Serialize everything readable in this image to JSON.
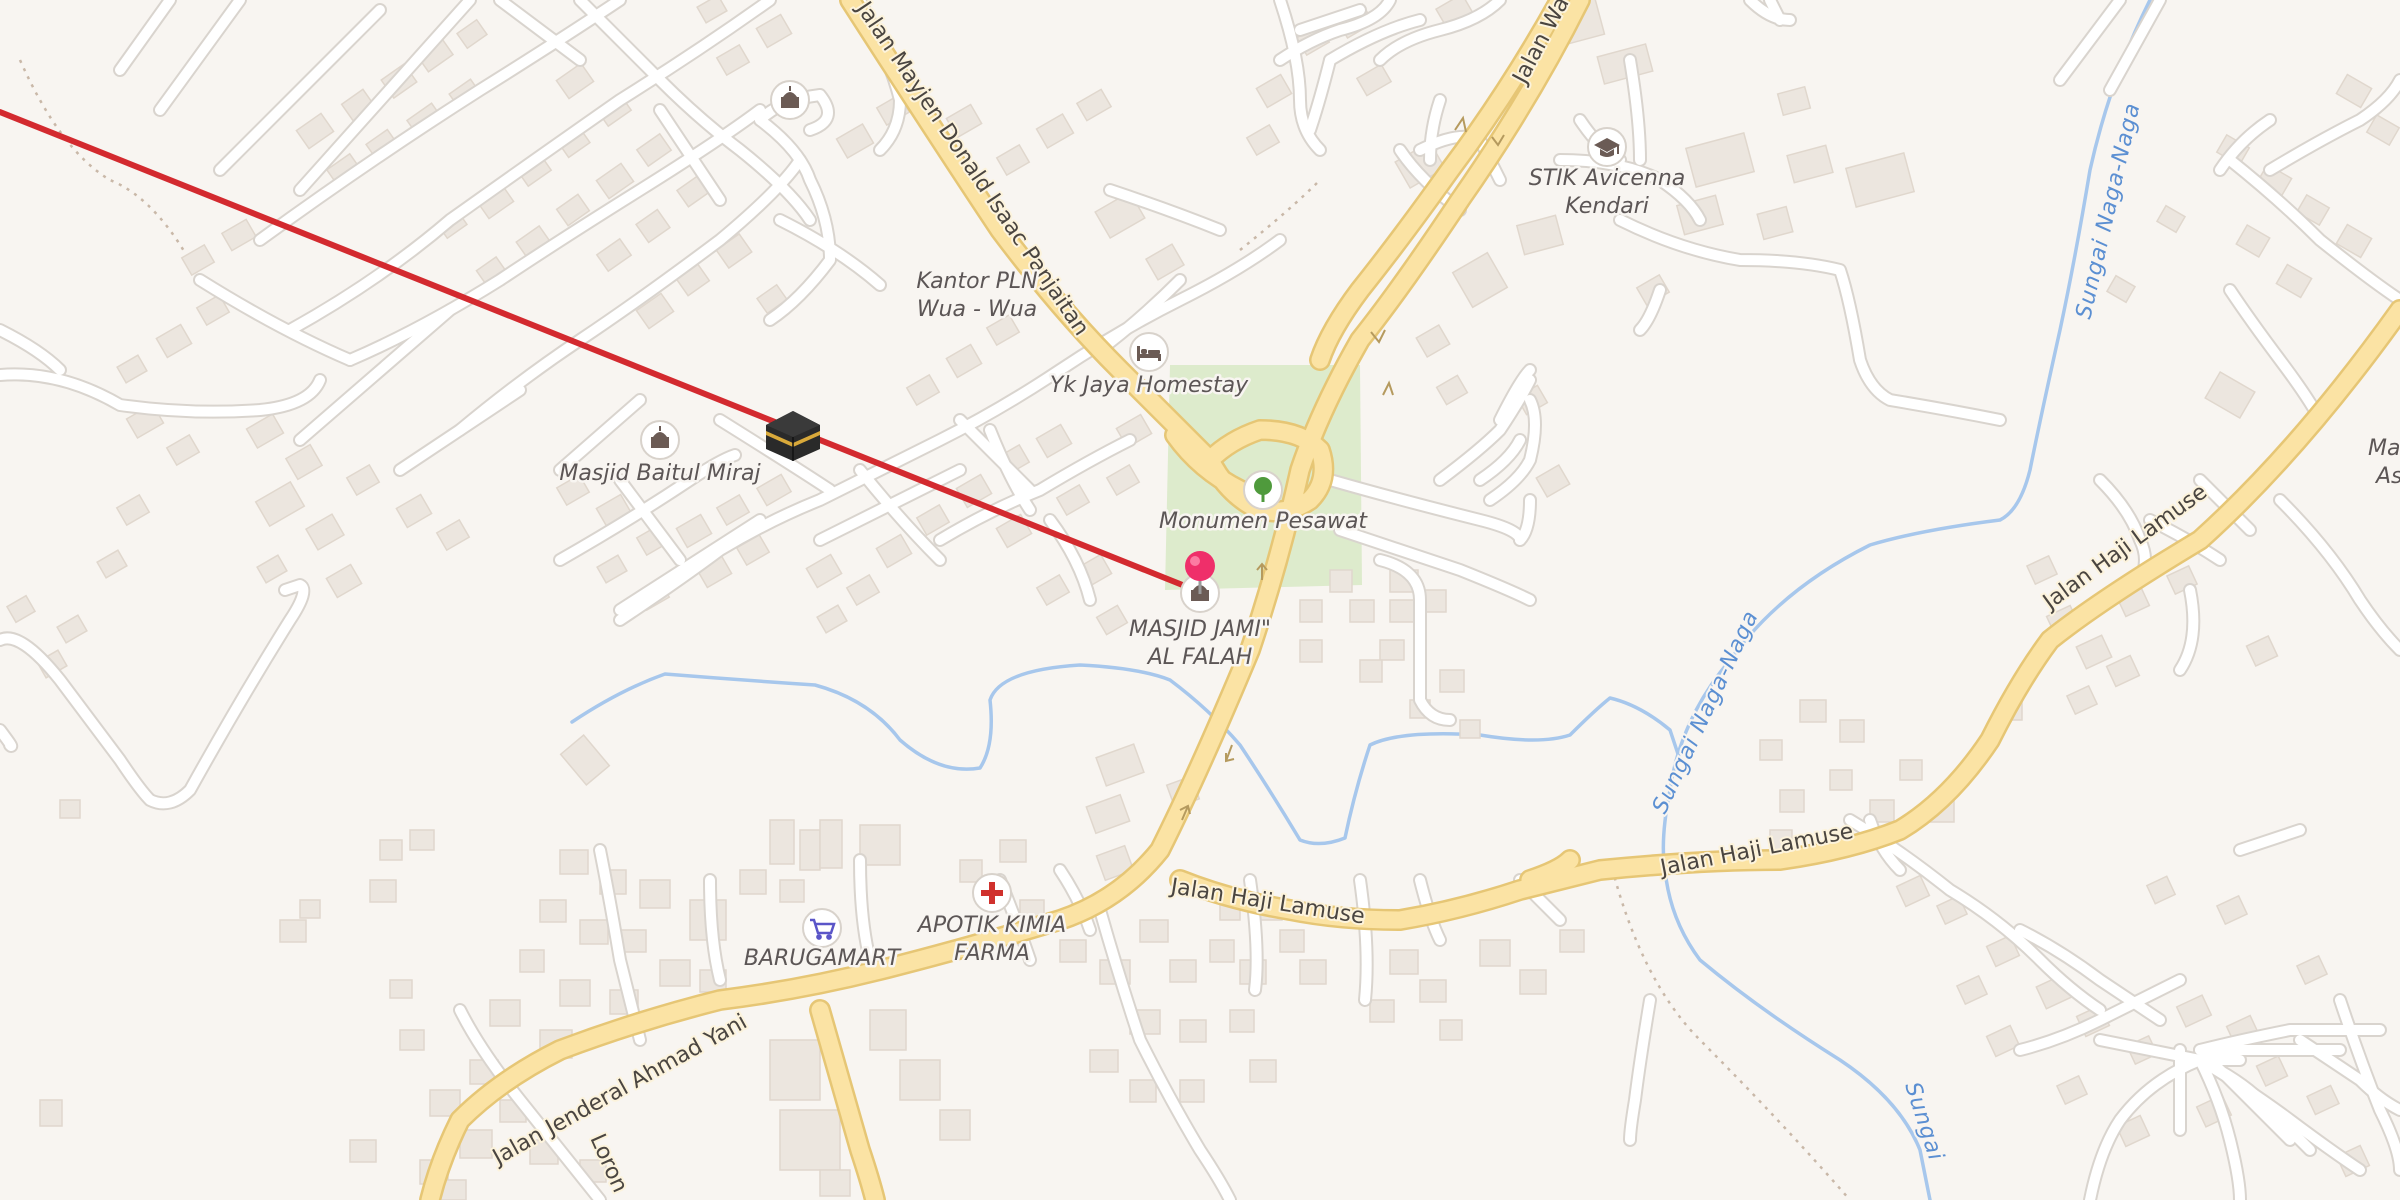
{
  "map": {
    "colors": {
      "background": "#f8f5f1",
      "major_road": "#fbe3a4",
      "minor_road": "#ffffff",
      "building": "#ece6df",
      "park": "#d8e9c6",
      "river": "#a7c7ec",
      "qibla_line": "#d32a2f",
      "pin": "#ef2f6a"
    },
    "roads": {
      "mayjen": "Jalan Mayjen Donald Isaac Panjaitan",
      "wa": "Jalan Wa",
      "ahmad_yani": "Jalan Jenderal Ahmad Yani",
      "lamuse_1": "Jalan Haji Lamuse",
      "lamuse_2": "Jalan Haji Lamuse",
      "lamuse_3": "Jalan Haji Lamuse",
      "lorong": "Loron"
    },
    "rivers": {
      "naga_1": "Sungai Naga-Naga",
      "naga_2": "Sungai Naga-Naga",
      "naga_3": "Sungai"
    },
    "pois": {
      "stik": [
        "STIK Avicenna",
        "Kendari"
      ],
      "kantor_pln": [
        "Kantor PLN",
        "Wua - Wua"
      ],
      "homestay": "Yk Jaya Homestay",
      "masjid_baitul": "Masjid Baitul Miraj",
      "monumen": "Monumen Pesawat",
      "masjid_jami": [
        "MASJID JAMI\"",
        "AL FALAH"
      ],
      "apotik": [
        "APOTIK KIMIA",
        "FARMA"
      ],
      "barugamart": "BARUGAMART",
      "masjid_right": [
        "Masji",
        "Ask"
      ]
    },
    "icons": {
      "mosque": "mosque-icon",
      "school": "graduation-cap-icon",
      "hotel": "bed-icon",
      "park": "tree-icon",
      "pharmacy": "red-cross-icon",
      "shop": "shopping-cart-icon",
      "kaaba": "kaaba-icon",
      "pin": "location-pin-icon"
    }
  }
}
